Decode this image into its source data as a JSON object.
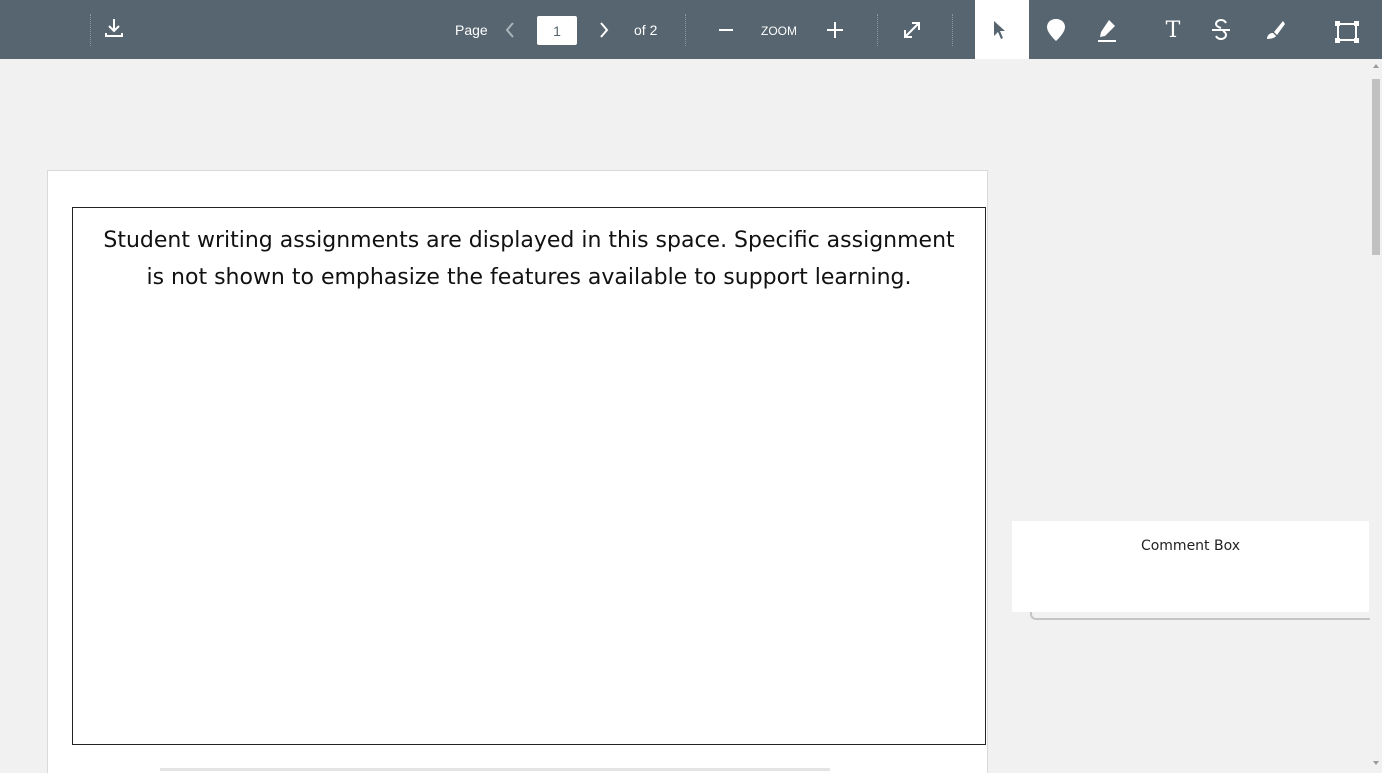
{
  "toolbar": {
    "page_label": "Page",
    "page_value": "1",
    "page_total": "of 2",
    "zoom_label": "ZOOM",
    "icons": {
      "download": "download-icon",
      "prev": "chevron-left-icon",
      "next": "chevron-right-icon",
      "zoom_out": "minus-icon",
      "zoom_in": "plus-icon",
      "expand": "expand-icon",
      "select": "cursor-icon",
      "pin": "pin-icon",
      "highlight": "highlighter-icon",
      "text": "text-icon",
      "strikethrough": "strikethrough-icon",
      "draw": "brush-icon",
      "area": "area-select-icon"
    },
    "colors": {
      "bar": "#56656f",
      "active_tool": "#ffffff"
    }
  },
  "document": {
    "assignment_text": "Student writing assignments are displayed in this space. Specific assignment is not shown to emphasize the features available to support learning."
  },
  "comment": {
    "label": "Comment Box"
  }
}
